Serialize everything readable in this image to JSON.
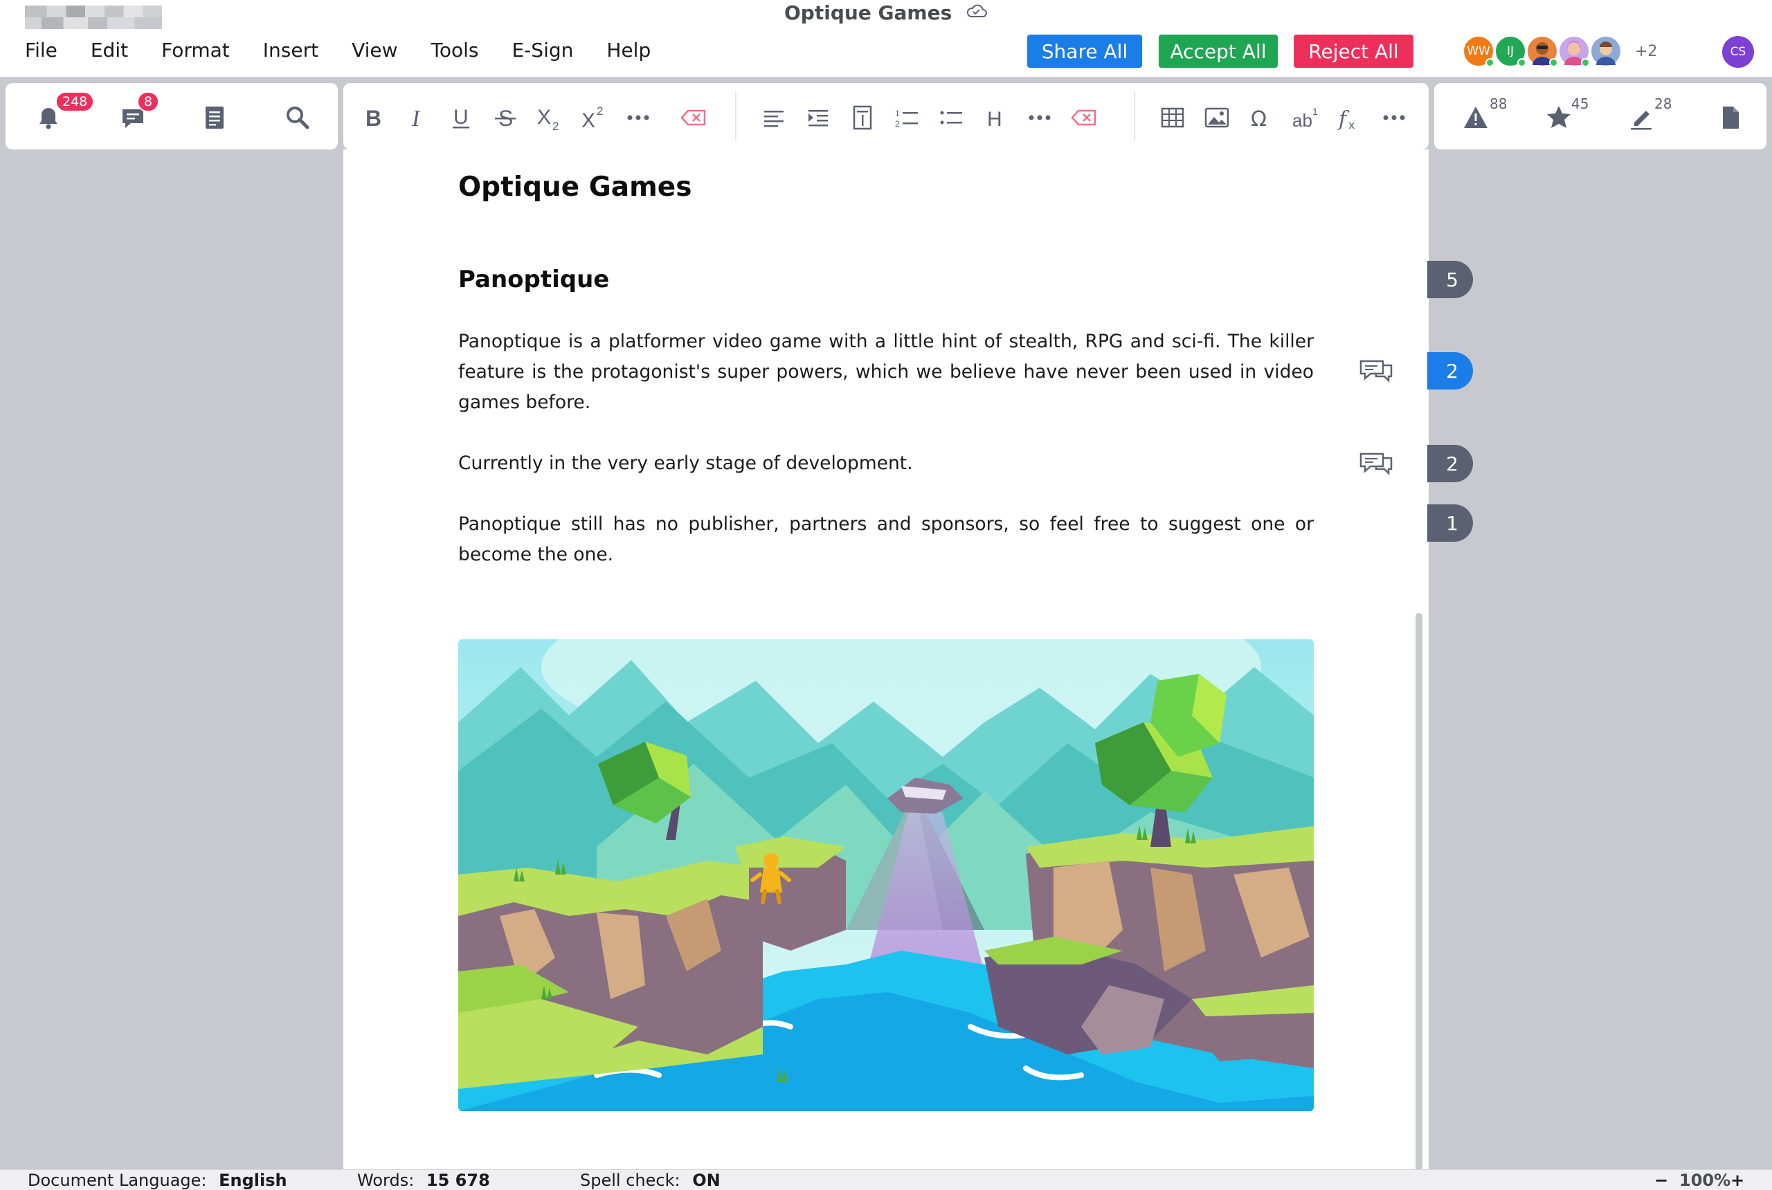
{
  "window": {
    "title": "Optique Games"
  },
  "menu": [
    "File",
    "Edit",
    "Format",
    "Insert",
    "View",
    "Tools",
    "E-Sign",
    "Help"
  ],
  "actions": {
    "share_all": "Share All",
    "accept_all": "Accept All",
    "reject_all": "Reject All"
  },
  "collaborators": {
    "avatars": [
      {
        "initials": "WW",
        "color": "#f07b16",
        "online": true
      },
      {
        "initials": "IJ",
        "color": "#22a754",
        "online": true
      },
      {
        "initials": "",
        "color": "#e9823a",
        "online": true
      },
      {
        "initials": "",
        "color": "#c7a5ea",
        "online": true
      },
      {
        "initials": "",
        "color": "#8ea9d6",
        "online": false
      }
    ],
    "more": "+2",
    "me": "CS"
  },
  "left_toolbar": {
    "notifications_badge": "248",
    "comments_badge": "8"
  },
  "right_toolbar": {
    "warnings_count": "88",
    "stars_count": "45",
    "edits_count": "28"
  },
  "document": {
    "title": "Optique Games",
    "heading": "Panoptique",
    "paragraph_1": "Panoptique is a platformer video game with a little hint of stealth, RPG and sci-fi. The killer feature is the protagonist's super powers, which we believe have never been used in video games before.",
    "paragraph_2": "Currently in the very early stage of development.",
    "paragraph_3": "Panoptique still has no publisher, partners and sponsors, so feel free to suggest one or become the one."
  },
  "comment_counters": [
    "5",
    "2",
    "2",
    "1"
  ],
  "status": {
    "language_label": "Document Language:",
    "language_value": "English",
    "words_label": "Words:",
    "words_value": "15 678",
    "spell_label": "Spell check:",
    "spell_value": "ON",
    "zoom": "100%",
    "zoom_out": "−",
    "zoom_in": "+"
  },
  "colors": {
    "accent_blue": "#1a7de8",
    "accept_green": "#1fa653",
    "reject_red": "#ee2f5c",
    "icon_gray": "#5b6172"
  }
}
